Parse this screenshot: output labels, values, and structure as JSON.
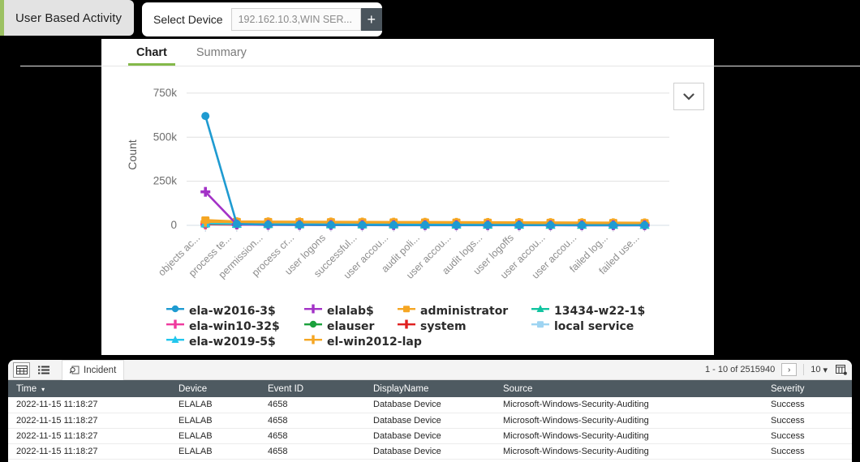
{
  "page_tab": {
    "label": "User Based Activity",
    "accent_color": "#9cc162"
  },
  "device_selector": {
    "label": "Select Device",
    "input_value": "192.162.10.3,WIN SER...",
    "input_placeholder": "Select Device",
    "add_button_label": "+"
  },
  "tabs": [
    {
      "label": "Chart",
      "active": true
    },
    {
      "label": "Summary",
      "active": false
    }
  ],
  "chart_menu_button": {
    "icon": "chevron-down-icon"
  },
  "chart_data": {
    "type": "line",
    "title": "",
    "xlabel": "",
    "ylabel": "Count",
    "ylim": [
      0,
      800000
    ],
    "yticks": [
      0,
      250000,
      500000,
      750000
    ],
    "ytick_labels": [
      "0",
      "250k",
      "500k",
      "750k"
    ],
    "grid": true,
    "legend_position": "bottom",
    "categories": [
      "objects ac...",
      "process te...",
      "permission...",
      "process cr...",
      "user logons",
      "successful...",
      "user accou...",
      "audit poli...",
      "user accou...",
      "audit logs...",
      "user logoffs",
      "user accou...",
      "user accou...",
      "failed log...",
      "failed use..."
    ],
    "series": [
      {
        "name": "ela-w2016-3$",
        "color": "#1f9bd1",
        "marker": "circle",
        "values": [
          620000,
          8000,
          4000,
          3000,
          2500,
          2000,
          1800,
          1500,
          1400,
          1300,
          1200,
          1100,
          1000,
          900,
          800
        ]
      },
      {
        "name": "elalab$",
        "color": "#a332c7",
        "marker": "plus",
        "values": [
          190000,
          5000,
          2500,
          2000,
          1500,
          1200,
          1000,
          900,
          800,
          700,
          600,
          550,
          500,
          450,
          400
        ]
      },
      {
        "name": "administrator",
        "color": "#f5a623",
        "marker": "square",
        "values": [
          30000,
          22000,
          21000,
          20500,
          20000,
          19500,
          19000,
          18500,
          18000,
          17500,
          17000,
          16500,
          16000,
          15500,
          15000
        ]
      },
      {
        "name": "13434-w22-1$",
        "color": "#11c4a0",
        "marker": "star",
        "values": [
          12000,
          9000,
          8000,
          7000,
          6500,
          6000,
          5500,
          5000,
          4500,
          4000,
          3800,
          3600,
          3400,
          3200,
          3000
        ]
      },
      {
        "name": "ela-win10-32$",
        "color": "#ef3a9e",
        "marker": "plus",
        "values": [
          9000,
          6000,
          5000,
          4500,
          4000,
          3500,
          3200,
          3000,
          2800,
          2600,
          2400,
          2200,
          2000,
          1800,
          1600
        ]
      },
      {
        "name": "elauser",
        "color": "#1ba13c",
        "marker": "circle",
        "values": [
          7000,
          5500,
          5000,
          4500,
          4200,
          4000,
          3800,
          3500,
          3200,
          3000,
          2800,
          2600,
          2400,
          2200,
          2000
        ]
      },
      {
        "name": "system",
        "color": "#e02020",
        "marker": "plus",
        "values": [
          6000,
          4500,
          4000,
          3500,
          3200,
          3000,
          2800,
          2600,
          2400,
          2200,
          2000,
          1900,
          1800,
          1700,
          1600
        ]
      },
      {
        "name": "local service",
        "color": "#9ed4f2",
        "marker": "square",
        "values": [
          5000,
          4000,
          3500,
          3000,
          2800,
          2600,
          2400,
          2200,
          2000,
          1900,
          1800,
          1700,
          1600,
          1500,
          1400
        ]
      },
      {
        "name": "ela-w2019-5$",
        "color": "#22c6ed",
        "marker": "star",
        "values": [
          14000,
          12000,
          11500,
          11000,
          10500,
          10000,
          9500,
          9000,
          8500,
          8000,
          7500,
          7200,
          7000,
          6800,
          6500
        ]
      },
      {
        "name": "el-win2012-lap",
        "color": "#f5a623",
        "marker": "plus",
        "values": [
          20000,
          18000,
          17500,
          17000,
          16500,
          16000,
          15500,
          15000,
          14500,
          14000,
          13500,
          13000,
          12500,
          12000,
          11500
        ]
      }
    ]
  },
  "grid_panel": {
    "toolbar": {
      "grid_view_icon": "grid-icon",
      "list_view_icon": "list-icon",
      "incident_tab_label": "Incident",
      "incident_tab_icon": "search-doc-icon",
      "pager_text": "1 - 10 of 2515940",
      "next_label": "›",
      "page_size": "10",
      "page_size_caret": "▾",
      "columns_icon": "columns-icon"
    },
    "columns": [
      "Time",
      "Device",
      "Event ID",
      "DisplayName",
      "Source",
      "Severity"
    ],
    "sort_column": "Time",
    "sort_indicator": "▾",
    "rows": [
      {
        "time": "2022-11-15 11:18:27",
        "device": "ELALAB",
        "event_id": "4658",
        "display_name": "Database Device",
        "source": "Microsoft-Windows-Security-Auditing",
        "severity": "Success"
      },
      {
        "time": "2022-11-15 11:18:27",
        "device": "ELALAB",
        "event_id": "4658",
        "display_name": "Database Device",
        "source": "Microsoft-Windows-Security-Auditing",
        "severity": "Success"
      },
      {
        "time": "2022-11-15 11:18:27",
        "device": "ELALAB",
        "event_id": "4658",
        "display_name": "Database Device",
        "source": "Microsoft-Windows-Security-Auditing",
        "severity": "Success"
      },
      {
        "time": "2022-11-15 11:18:27",
        "device": "ELALAB",
        "event_id": "4658",
        "display_name": "Database Device",
        "source": "Microsoft-Windows-Security-Auditing",
        "severity": "Success"
      }
    ]
  }
}
